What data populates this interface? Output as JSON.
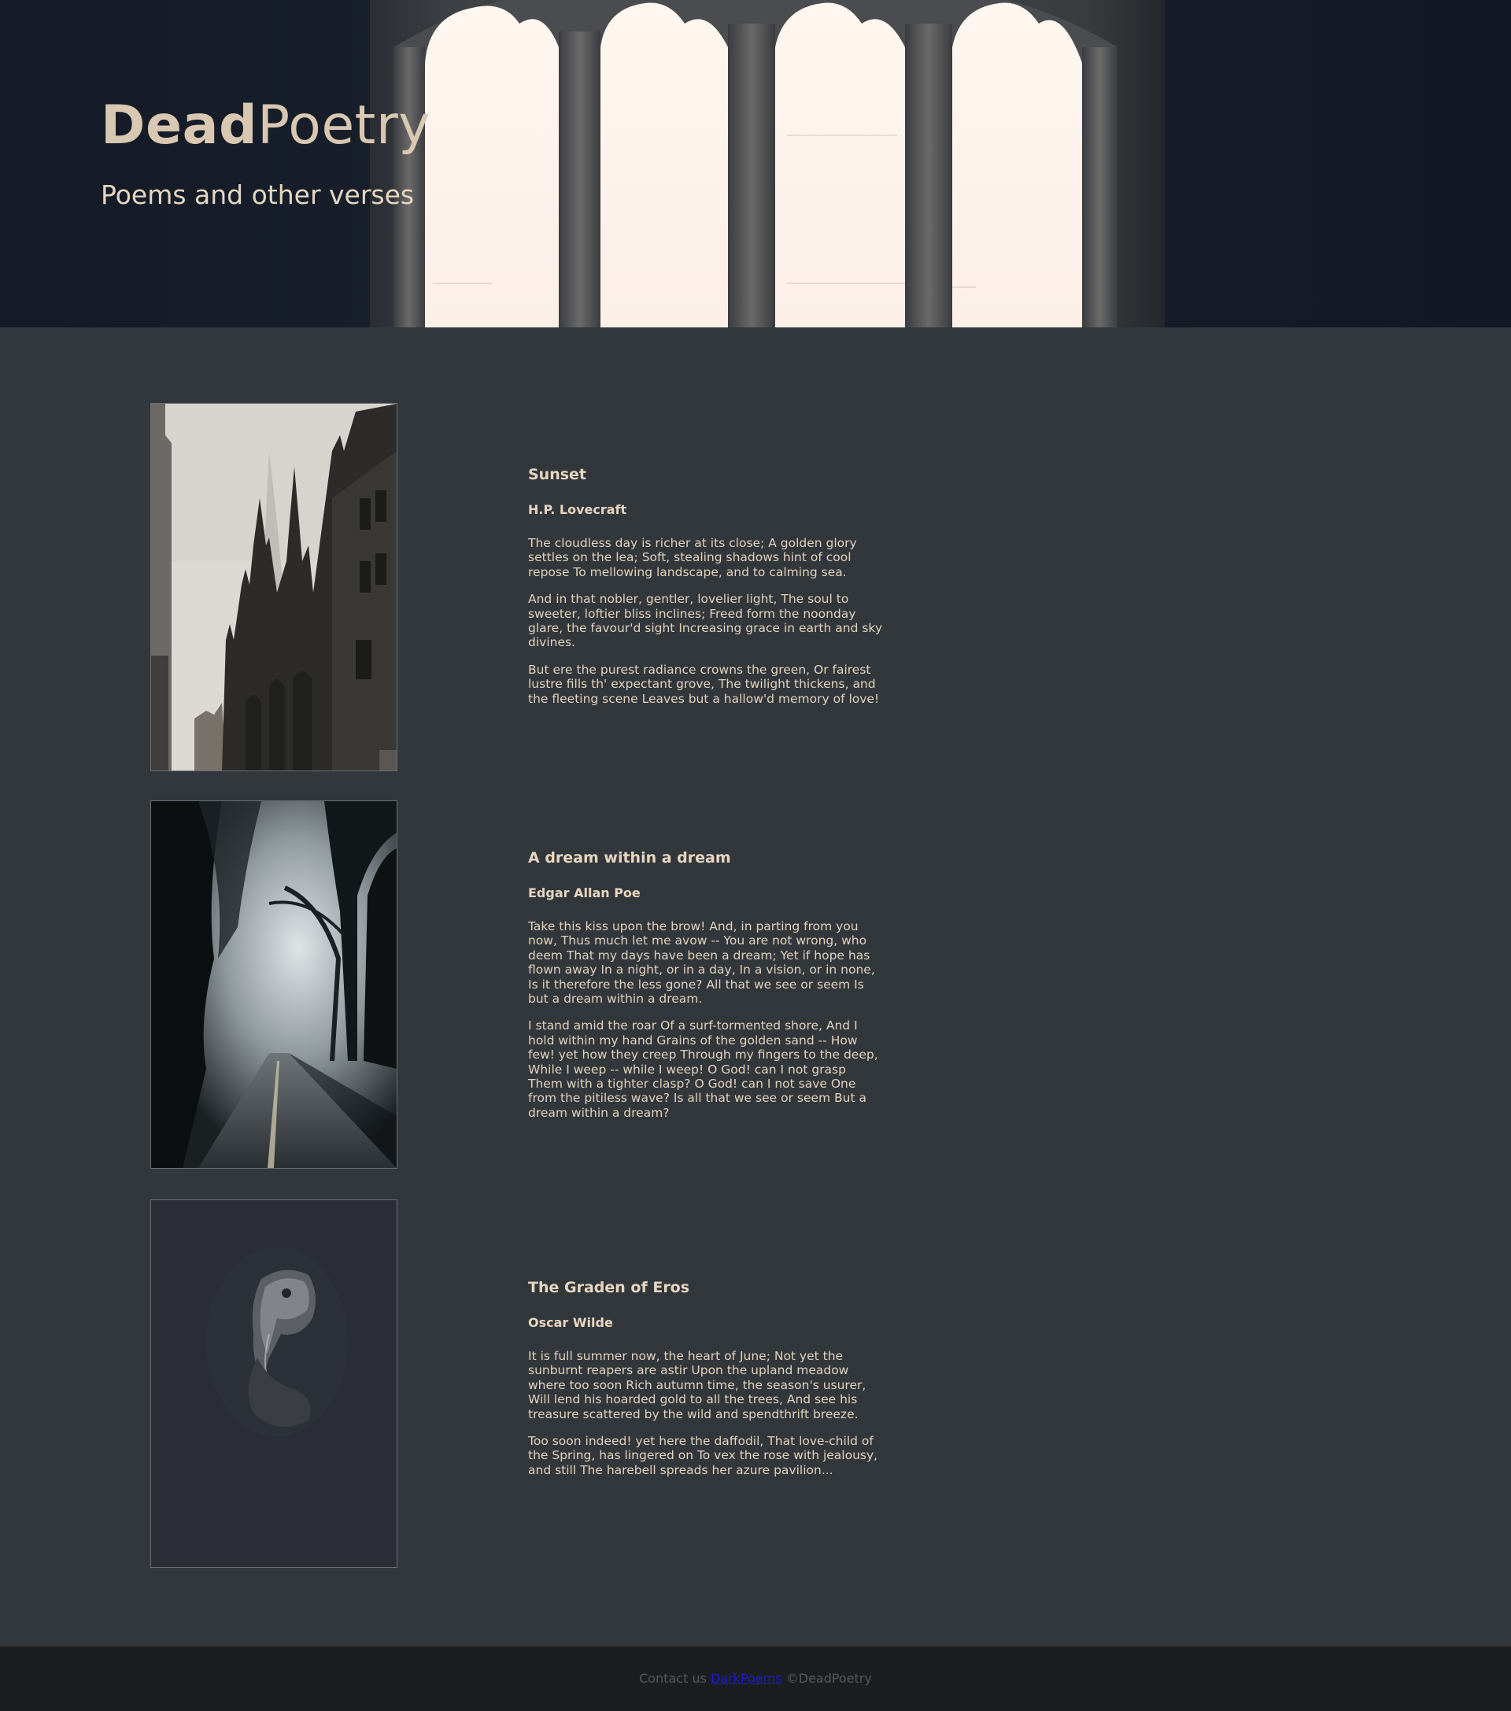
{
  "header": {
    "brand_bold": "Dead",
    "brand_light": "Poetry",
    "tagline": "Poems and other verses"
  },
  "poems": [
    {
      "title": "Sunset",
      "author": "H.P. Lovecraft",
      "image": "gothic-cathedral-fog",
      "stanzas": [
        "The cloudless day is richer at its close; A golden glory settles on the lea; Soft, stealing shadows hint of cool repose To mellowing landscape, and to calming sea.",
        "And in that nobler, gentler, lovelier light, The soul to sweeter, loftier bliss inclines; Freed form the noonday glare, the favour'd sight Increasing grace in earth and sky divines.",
        "But ere the purest radiance crowns the green, Or fairest lustre fills th' expectant grove, The twilight thickens, and the fleeting scene Leaves but a hallow'd memory of love!"
      ]
    },
    {
      "title": "A dream within a dream",
      "author": "Edgar Allan Poe",
      "image": "foggy-forest-road",
      "stanzas": [
        "Take this kiss upon the brow! And, in parting from you now, Thus much let me avow -- You are not wrong, who deem That my days have been a dream; Yet if hope has flown away In a night, or in a day, In a vision, or in none, Is it therefore the less gone? All that we see or seem Is but a dream within a dream.",
        "I stand amid the roar Of a surf-tormented shore, And I hold within my hand Grains of the golden sand -- How few! yet how they creep Through my fingers to the deep, While I weep -- while I weep! O God! can I not grasp Them with a tighter clasp? O God! can I not save One from the pitiless wave? Is all that we see or seem But a dream within a dream?"
      ]
    },
    {
      "title": "The Graden of Eros",
      "author": "Oscar Wilde",
      "image": "plague-doctor-mask",
      "stanzas": [
        "It is full summer now, the heart of June; Not yet the sunburnt reapers are astir Upon the upland meadow where too soon Rich autumn time, the season's usurer, Will lend his hoarded gold to all the trees, And see his treasure scattered by the wild and spendthrift breeze.",
        "Too soon indeed! yet here the daffodil, That love-child of the Spring, has lingered on To vex the rose with jealousy, and still The harebell spreads her azure pavilion..."
      ]
    }
  ],
  "footer": {
    "prefix": "Contact us",
    "link_label": "DarkPoems",
    "suffix": "©DeadPoetry"
  },
  "colors": {
    "page_bg": "#32373c",
    "footer_bg": "#1c1d1f",
    "text": "#e8d9c4",
    "link": "#1a1ec8"
  }
}
